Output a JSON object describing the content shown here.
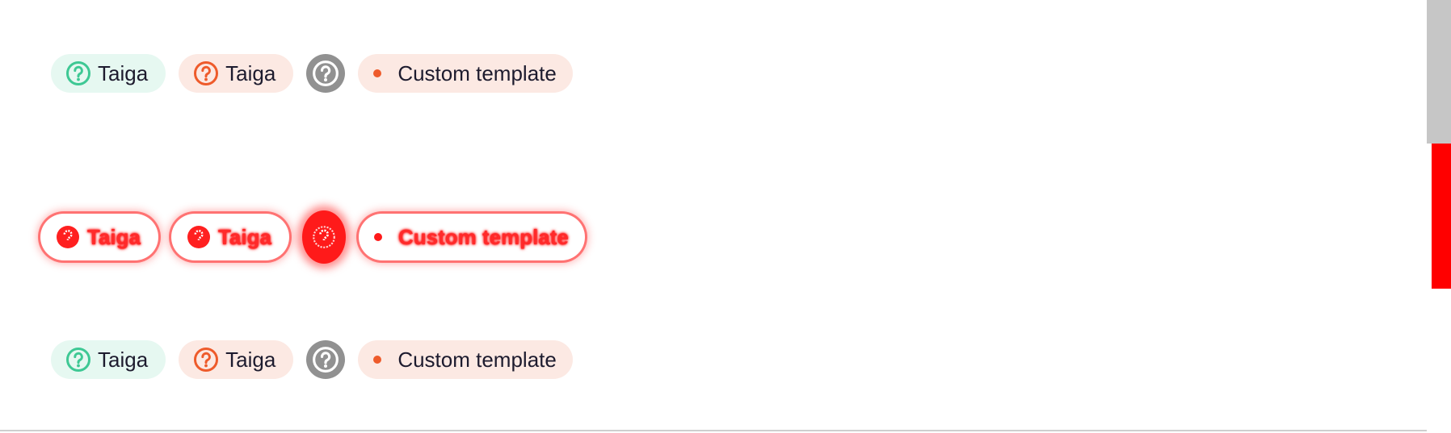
{
  "rows": [
    {
      "tags": [
        {
          "label": "Taiga",
          "variant": "green",
          "icon": "question-circle-icon",
          "icon_color": "#3ec894"
        },
        {
          "label": "Taiga",
          "variant": "orange",
          "icon": "question-circle-icon",
          "icon_color": "#ee5b2b"
        },
        {
          "label": "",
          "variant": "icon-only",
          "icon": "question-circle-icon",
          "icon_color": "#ffffff"
        },
        {
          "label": "Custom template",
          "variant": "custom",
          "icon": "dot-icon",
          "icon_color": "#ee5b2b"
        }
      ]
    },
    {
      "state": "glitched",
      "tags": [
        {
          "label": "Taiga",
          "variant": "green",
          "icon": "question-circle-icon"
        },
        {
          "label": "Taiga",
          "variant": "orange",
          "icon": "question-circle-icon"
        },
        {
          "label": "",
          "variant": "icon-only",
          "icon": "question-circle-icon"
        },
        {
          "label": "Custom template",
          "variant": "custom",
          "icon": "dot-icon"
        }
      ]
    },
    {
      "tags": [
        {
          "label": "Taiga",
          "variant": "green",
          "icon": "question-circle-icon",
          "icon_color": "#3ec894"
        },
        {
          "label": "Taiga",
          "variant": "orange",
          "icon": "question-circle-icon",
          "icon_color": "#ee5b2b"
        },
        {
          "label": "",
          "variant": "icon-only",
          "icon": "question-circle-icon",
          "icon_color": "#ffffff"
        },
        {
          "label": "Custom template",
          "variant": "custom",
          "icon": "dot-icon",
          "icon_color": "#ee5b2b"
        }
      ]
    }
  ],
  "colors": {
    "green_bg": "#e6f8f1",
    "green_accent": "#3ec894",
    "orange_bg": "#fce9e3",
    "orange_accent": "#ee5b2b",
    "grey_badge": "#919191",
    "text": "#1d1b2e",
    "glitch_red": "#ff0000"
  }
}
